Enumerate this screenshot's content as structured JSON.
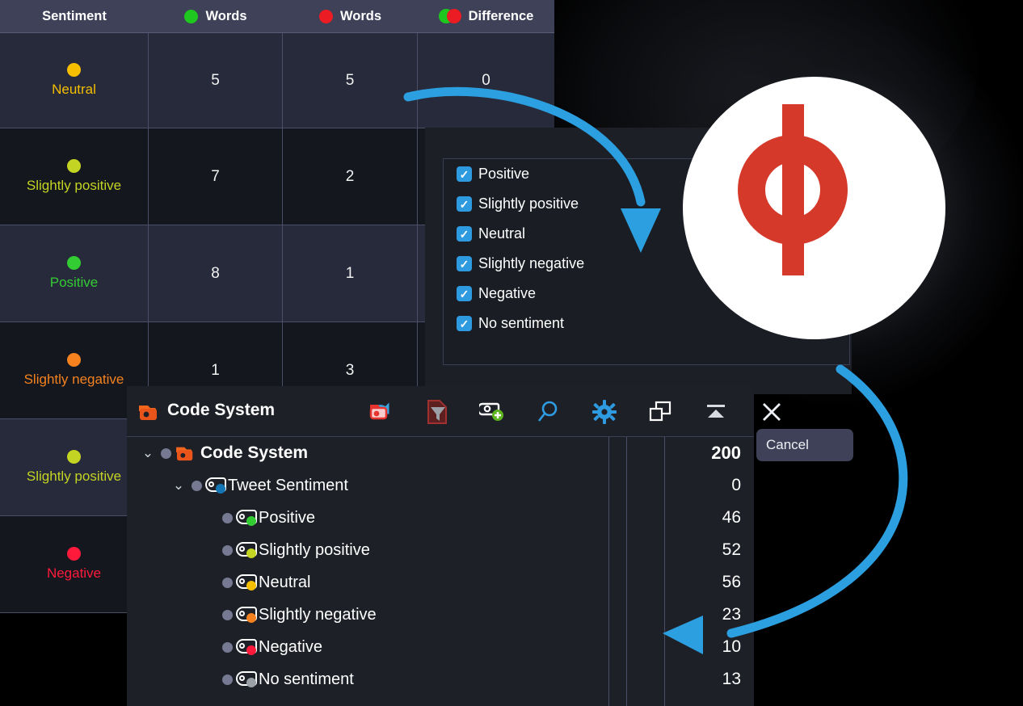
{
  "colors": {
    "accent_blue": "#2e9ae0",
    "arrow_blue": "#2b9fe0",
    "header_bg": "#3e4157",
    "row_alt_bg": "#272a3a",
    "row_bg": "#14171e",
    "positive": "#33cc33",
    "slightly_positive": "#c4d422",
    "neutral": "#f5bf00",
    "slightly_negative": "#f5821f",
    "negative": "#ff1a3c",
    "no_sentiment": "#9aa0a6",
    "brand_red": "#d4392a",
    "brand_orange": "#f2651c",
    "venn_green": "#1ec81e",
    "venn_red": "#ec1c24"
  },
  "table": {
    "columns": [
      {
        "label": "Sentiment",
        "icon": "none"
      },
      {
        "label": "Words",
        "icon": "green-dot"
      },
      {
        "label": "Words",
        "icon": "red-dot"
      },
      {
        "label": "Difference",
        "icon": "venn-icon"
      }
    ],
    "rows": [
      {
        "sentiment": "Neutral",
        "color": "#f5bf00",
        "green_words": "5",
        "red_words": "5",
        "difference": "0",
        "highlighted": true
      },
      {
        "sentiment": "Slightly positive",
        "color": "#c4d422",
        "green_words": "7",
        "red_words": "2",
        "difference": "",
        "highlighted": false
      },
      {
        "sentiment": "Positive",
        "color": "#33cc33",
        "green_words": "8",
        "red_words": "1",
        "difference": "",
        "highlighted": true
      },
      {
        "sentiment": "Slightly negative",
        "color": "#f5821f",
        "green_words": "1",
        "red_words": "3",
        "difference": "",
        "highlighted": false
      },
      {
        "sentiment": "Slightly positive",
        "color": "#c4d422",
        "green_words": "",
        "red_words": "",
        "difference": "",
        "highlighted": true
      },
      {
        "sentiment": "Negative",
        "color": "#ff1a3c",
        "green_words": "",
        "red_words": "",
        "difference": "",
        "highlighted": false
      }
    ]
  },
  "checkbox_panel": {
    "items": [
      {
        "label": "Positive",
        "checked": true
      },
      {
        "label": "Slightly positive",
        "checked": true
      },
      {
        "label": "Neutral",
        "checked": true
      },
      {
        "label": "Slightly negative",
        "checked": true
      },
      {
        "label": "Negative",
        "checked": true
      },
      {
        "label": "No sentiment",
        "checked": true
      }
    ]
  },
  "code_system_window": {
    "title": "Code System",
    "toolbar": [
      {
        "name": "undo-code-icon",
        "tooltip": "Undo"
      },
      {
        "name": "filter-icon",
        "tooltip": "Filter"
      },
      {
        "name": "new-code-icon",
        "tooltip": "New code"
      },
      {
        "name": "search-icon",
        "tooltip": "Search"
      },
      {
        "name": "settings-gear-icon",
        "tooltip": "Settings"
      },
      {
        "name": "detach-window-icon",
        "tooltip": "Detach"
      },
      {
        "name": "collapse-icon",
        "tooltip": "Collapse"
      },
      {
        "name": "close-icon",
        "tooltip": "Close"
      }
    ],
    "tree": [
      {
        "label": "Code System",
        "indent": 0,
        "caret": "down",
        "icon": "folder-code-icon",
        "dot": "",
        "value": "200",
        "bold": true
      },
      {
        "label": "Tweet Sentiment",
        "indent": 1,
        "caret": "down",
        "icon": "code-icon",
        "dot": "#1476b4",
        "value": "0",
        "bold": false
      },
      {
        "label": "Positive",
        "indent": 2,
        "caret": "",
        "icon": "code-icon",
        "dot": "#33cc33",
        "value": "46",
        "bold": false
      },
      {
        "label": "Slightly positive",
        "indent": 2,
        "caret": "",
        "icon": "code-icon",
        "dot": "#c4d422",
        "value": "52",
        "bold": false
      },
      {
        "label": "Neutral",
        "indent": 2,
        "caret": "",
        "icon": "code-icon",
        "dot": "#f5bf00",
        "value": "56",
        "bold": false
      },
      {
        "label": "Slightly negative",
        "indent": 2,
        "caret": "",
        "icon": "code-icon",
        "dot": "#f5821f",
        "value": "23",
        "bold": false
      },
      {
        "label": "Negative",
        "indent": 2,
        "caret": "",
        "icon": "code-icon",
        "dot": "#ff1a3c",
        "value": "10",
        "bold": false
      },
      {
        "label": "No sentiment",
        "indent": 2,
        "caret": "",
        "icon": "code-icon",
        "dot": "#9aa0a6",
        "value": "13",
        "bold": false
      }
    ]
  },
  "tooltip": {
    "cancel_label": "Cancel"
  },
  "logo": {
    "name": "maxqda-logo"
  }
}
